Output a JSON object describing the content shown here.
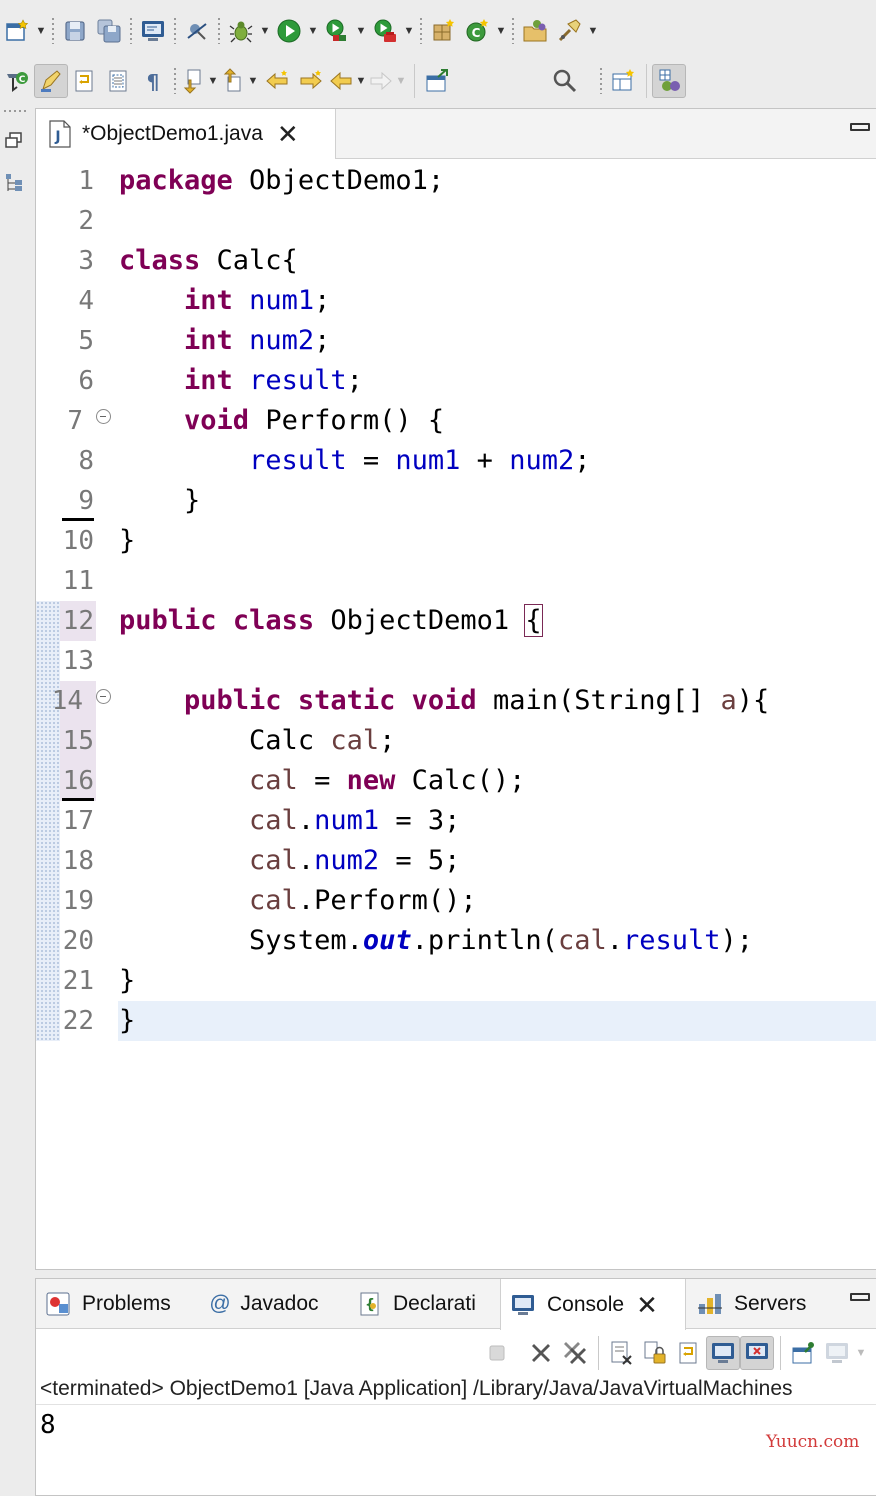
{
  "toolbar_top": {
    "groups": [
      [
        "new-wizard-icon",
        "save-icon",
        "save-all-icon"
      ],
      [
        "console-icon"
      ],
      [
        "skip-breakpoints-icon"
      ],
      [
        "debug-icon",
        "run-icon",
        "coverage-icon",
        "external-tools-icon"
      ],
      [
        "new-java-package-icon",
        "new-java-class-icon"
      ],
      [
        "open-type-icon",
        "search-icon"
      ]
    ]
  },
  "toolbar_second": {
    "items": [
      "toggle-breakpoint-icon",
      "mark-occurrences-icon",
      "word-wrap-icon",
      "block-selection-icon",
      "show-whitespace-icon",
      "next-annotation-icon",
      "previous-annotation-icon",
      "last-edit-icon",
      "back-icon",
      "forward-icon",
      "open-perspective-icon",
      "search-icon",
      "java-perspective-icon"
    ]
  },
  "editor": {
    "tab_title": "*ObjectDemo1.java",
    "line_numbers": [
      "1",
      "2",
      "3",
      "4",
      "5",
      "6",
      "7",
      "8",
      "9",
      "10",
      "11",
      "12",
      "13",
      "14",
      "15",
      "16",
      "17",
      "18",
      "19",
      "20",
      "21",
      "22"
    ],
    "current_line": "22"
  },
  "code": {
    "l1_kw": "package",
    "l1_rest": " ObjectDemo1;",
    "l3_kw": "class",
    "l3_rest": " Calc{",
    "l4_indent": "    ",
    "l4_type": "int",
    "l4_field": "num1",
    "l4_end": ";",
    "l5_indent": "    ",
    "l5_type": "int",
    "l5_field": "num2",
    "l5_end": ";",
    "l6_indent": "    ",
    "l6_type": "int",
    "l6_field": "result",
    "l6_end": ";",
    "l7_indent": "    ",
    "l7_kw": "void",
    "l7_rest": " Perform() {",
    "l8_indent": "        ",
    "l8_f1": "result",
    "l8_op1": " = ",
    "l8_f2": "num1",
    "l8_op2": " + ",
    "l8_f3": "num2",
    "l8_end": ";",
    "l9_text": "    }",
    "l10_text": "}",
    "l12_kw1": "public",
    "l12_kw2": "class",
    "l12_name": " ObjectDemo1 ",
    "l12_brace": "{",
    "l14_indent": "    ",
    "l14_kw1": "public",
    "l14_kw2": "static",
    "l14_kw3": "void",
    "l14_sig": " main(String[] ",
    "l14_param": "a",
    "l14_end": "){",
    "l15_indent": "        ",
    "l15_type": "Calc ",
    "l15_var": "cal",
    "l15_end": ";",
    "l16_indent": "        ",
    "l16_var": "cal",
    "l16_op": " = ",
    "l16_kw": "new",
    "l16_rest": " Calc();",
    "l17_indent": "        ",
    "l17_var": "cal",
    "l17_dot": ".",
    "l17_field": "num1",
    "l17_rest": " = 3;",
    "l18_indent": "        ",
    "l18_var": "cal",
    "l18_dot": ".",
    "l18_field": "num2",
    "l18_rest": " = 5;",
    "l19_indent": "        ",
    "l19_var": "cal",
    "l19_rest": ".Perform();",
    "l20_indent": "        ",
    "l20_pre": "System.",
    "l20_static": "out",
    "l20_mid": ".println(",
    "l20_var": "cal",
    "l20_dot": ".",
    "l20_field": "result",
    "l20_end": ");",
    "l21_text": "}",
    "l22_text": "}"
  },
  "bottom_panel": {
    "tabs": [
      {
        "label": "Problems",
        "icon": "problems-icon"
      },
      {
        "label": "@",
        "icon": "javadoc-icon"
      },
      {
        "label": "Javadoc"
      },
      {
        "label": "Declarati",
        "icon": "declaration-icon"
      },
      {
        "label": "Console",
        "icon": "console-icon",
        "active": true
      },
      {
        "label": "Servers",
        "icon": "servers-icon"
      }
    ],
    "console_status": "<terminated> ObjectDemo1 [Java Application] /Library/Java/JavaVirtualMachines",
    "console_output": "8"
  },
  "watermark": "Yuucn.com",
  "colors": {
    "keyword": "#7f0055",
    "field": "#0000c0",
    "local_variable": "#6a3e3e",
    "line_number": "#787878",
    "current_line": "#e8f0fa",
    "watermark": "#d23a3a"
  }
}
